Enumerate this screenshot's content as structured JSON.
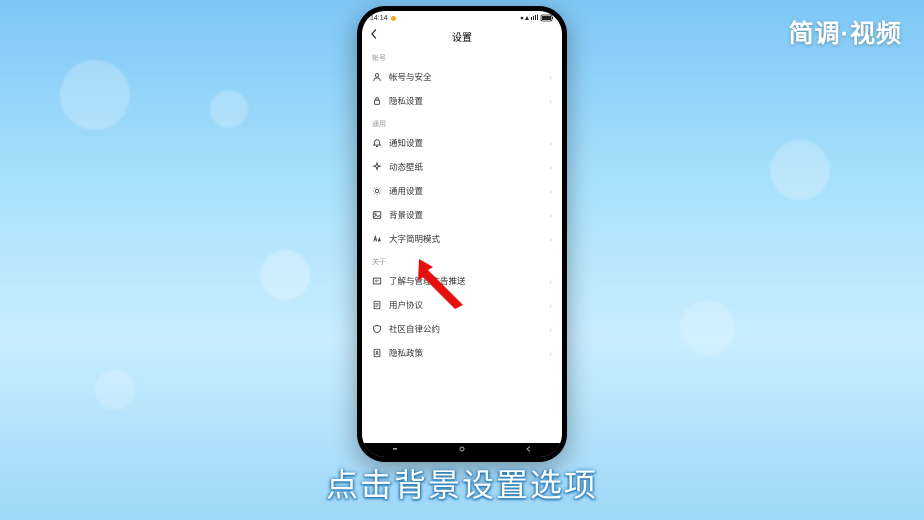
{
  "watermark": "简调·视频",
  "caption": "点击背景设置选项",
  "status": {
    "time": "14:14"
  },
  "header": {
    "title": "设置"
  },
  "sections": {
    "account": {
      "title": "帐号",
      "items": [
        "帐号与安全",
        "隐私设置"
      ]
    },
    "general": {
      "title": "通用",
      "items": [
        "通知设置",
        "动态壁纸",
        "通用设置",
        "背景设置",
        "大字简明模式"
      ]
    },
    "about": {
      "title": "关于",
      "items": [
        "了解与管理广告推送",
        "用户协议",
        "社区自律公约",
        "隐私政策"
      ]
    }
  }
}
